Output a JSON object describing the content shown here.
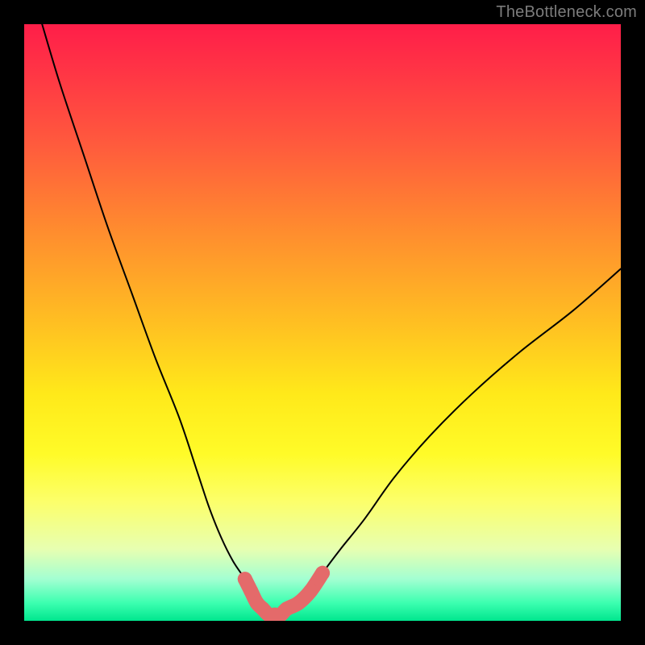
{
  "watermark": {
    "text": "TheBottleneck.com"
  },
  "colors": {
    "background": "#000000",
    "curve": "#000000",
    "markers": "#e46a6a",
    "gradient_top": "#ff1e49",
    "gradient_mid": "#ffe91a",
    "gradient_bottom": "#00e68e"
  },
  "chart_data": {
    "type": "line",
    "title": "",
    "xlabel": "",
    "ylabel": "",
    "xlim": [
      0,
      100
    ],
    "ylim": [
      0,
      100
    ],
    "grid": false,
    "series": [
      {
        "name": "bottleneck-curve",
        "x": [
          3,
          6,
          10,
          14,
          18,
          22,
          26,
          29,
          31,
          33,
          35,
          37,
          38,
          39,
          40,
          41,
          42,
          43,
          44,
          46,
          48,
          50,
          53,
          57,
          62,
          68,
          75,
          83,
          92,
          100
        ],
        "values": [
          100,
          90,
          78,
          66,
          55,
          44,
          34,
          25,
          19,
          14,
          10,
          7,
          5,
          3,
          2,
          1,
          1,
          1,
          2,
          3,
          5,
          8,
          12,
          17,
          24,
          31,
          38,
          45,
          52,
          59
        ]
      }
    ],
    "highlight_range": {
      "name": "near-optimum-band",
      "curve": "bottleneck-curve",
      "x_from": 32,
      "x_to": 50,
      "threshold_value": 8
    }
  }
}
